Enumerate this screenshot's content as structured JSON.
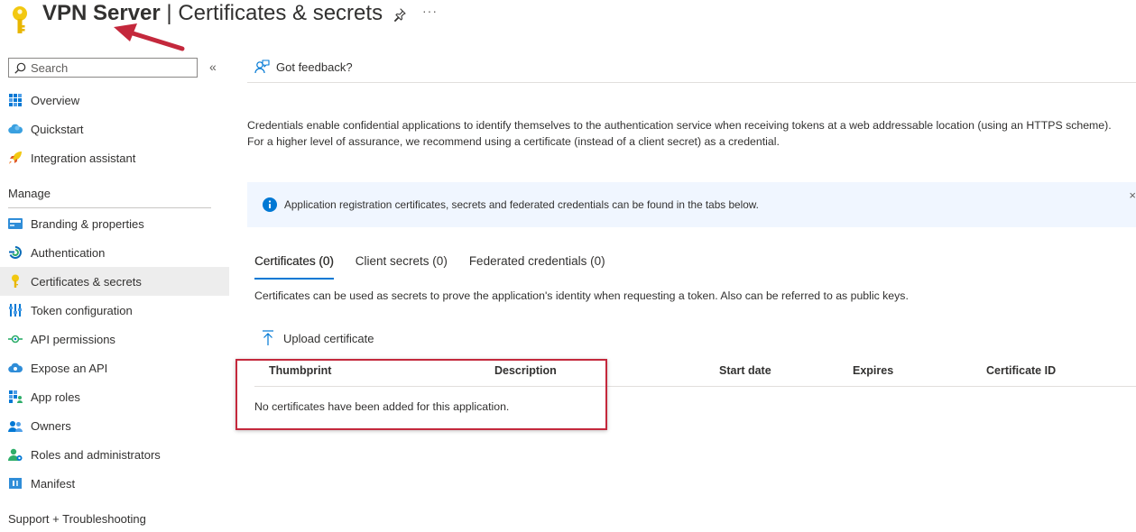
{
  "header": {
    "app_name": "VPN Server",
    "separator": "|",
    "page_title": "Certificates & secrets",
    "more_label": "···"
  },
  "sidebar": {
    "search_placeholder": "Search",
    "collapse_label": "«",
    "top_items": [
      {
        "label": "Overview",
        "icon": "overview-grid-icon"
      },
      {
        "label": "Quickstart",
        "icon": "cloud-icon"
      },
      {
        "label": "Integration assistant",
        "icon": "rocket-icon"
      }
    ],
    "manage_heading": "Manage",
    "manage_items": [
      {
        "label": "Branding & properties",
        "icon": "branding-icon"
      },
      {
        "label": "Authentication",
        "icon": "authentication-icon"
      },
      {
        "label": "Certificates & secrets",
        "icon": "key-icon",
        "selected": true
      },
      {
        "label": "Token configuration",
        "icon": "token-bars-icon"
      },
      {
        "label": "API permissions",
        "icon": "api-permissions-icon"
      },
      {
        "label": "Expose an API",
        "icon": "cloud-api-icon"
      },
      {
        "label": "App roles",
        "icon": "app-roles-icon"
      },
      {
        "label": "Owners",
        "icon": "owners-icon"
      },
      {
        "label": "Roles and administrators",
        "icon": "roles-admin-icon"
      },
      {
        "label": "Manifest",
        "icon": "manifest-icon"
      }
    ],
    "support_heading": "Support + Troubleshooting"
  },
  "main": {
    "feedback_label": "Got feedback?",
    "intro_text": "Credentials enable confidential applications to identify themselves to the authentication service when receiving tokens at a web addressable location (using an HTTPS scheme). For a higher level of assurance, we recommend using a certificate (instead of a client secret) as a credential.",
    "info_text": "Application registration certificates, secrets and federated credentials can be found in the tabs below.",
    "info_close": "×",
    "tabs": [
      {
        "label": "Certificates (0)",
        "active": true
      },
      {
        "label": "Client secrets (0)",
        "active": false
      },
      {
        "label": "Federated credentials (0)",
        "active": false
      }
    ],
    "tab_description": "Certificates can be used as secrets to prove the application's identity when requesting a token. Also can be referred to as public keys.",
    "upload_label": "Upload certificate",
    "table": {
      "columns": [
        "Thumbprint",
        "Description",
        "Start date",
        "Expires",
        "Certificate ID"
      ],
      "empty_message": "No certificates have been added for this application."
    }
  },
  "colors": {
    "accent": "#0078d4",
    "key_gold": "#f2c811",
    "annotation_red": "#c4283c",
    "info_bg": "#f0f6ff",
    "selected_bg": "#ededed"
  }
}
